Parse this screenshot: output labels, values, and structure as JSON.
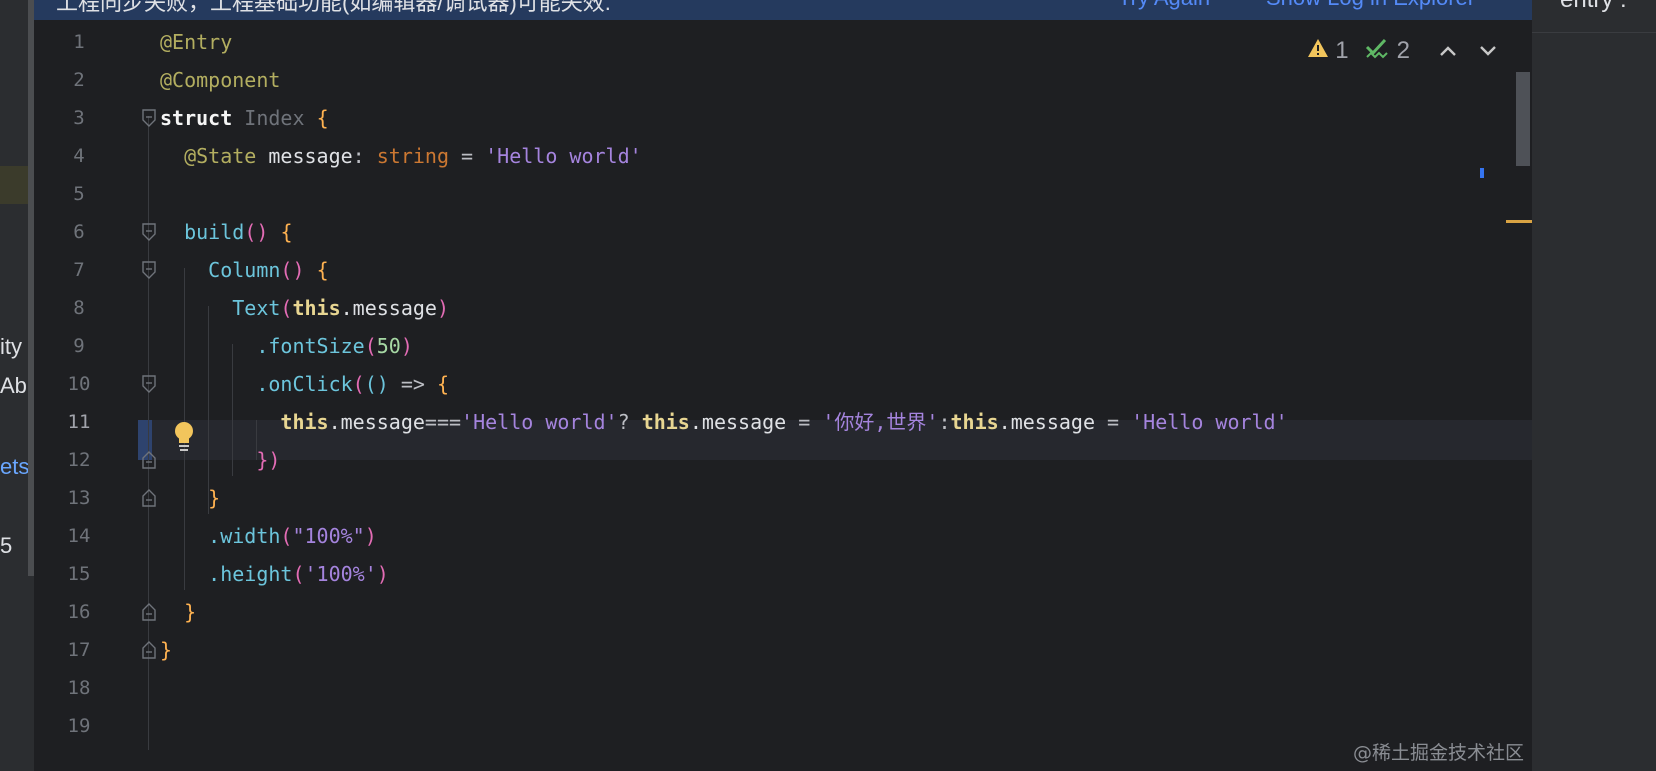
{
  "banner": {
    "message": "工程同步失败，工程基础功能(如编辑器/调试器)可能失效.",
    "try_again": "Try Again",
    "show_log": "Show Log in Explorer"
  },
  "left_panel": {
    "fragments": [
      "",
      "ity",
      "Abil",
      "ets",
      "5"
    ]
  },
  "right_panel": {
    "header": "entry :"
  },
  "inspections": {
    "warnings": "1",
    "weak_warnings": "2"
  },
  "editor": {
    "current_line": 11,
    "line_numbers": [
      "1",
      "2",
      "3",
      "4",
      "5",
      "6",
      "7",
      "8",
      "9",
      "10",
      "11",
      "12",
      "13",
      "14",
      "15",
      "16",
      "17",
      "18",
      "19"
    ],
    "lines": [
      [
        [
          "@Entry",
          "anno"
        ]
      ],
      [
        [
          "@Component",
          "anno"
        ]
      ],
      [
        [
          "struct",
          "kwb"
        ],
        [
          " ",
          "op"
        ],
        [
          "Index",
          "type"
        ],
        [
          " ",
          "op"
        ],
        [
          "{",
          "p1"
        ]
      ],
      [
        [
          "  ",
          "op"
        ],
        [
          "@State",
          "anno"
        ],
        [
          " message",
          "id"
        ],
        [
          ": ",
          "op"
        ],
        [
          "string",
          "tp"
        ],
        [
          " = ",
          "op"
        ],
        [
          "'Hello world'",
          "str"
        ]
      ],
      [],
      [
        [
          "  ",
          "op"
        ],
        [
          "build",
          "comp"
        ],
        [
          "()",
          "p2"
        ],
        [
          " ",
          "op"
        ],
        [
          "{",
          "p1"
        ]
      ],
      [
        [
          "    ",
          "op"
        ],
        [
          "Column",
          "comp"
        ],
        [
          "()",
          "p2"
        ],
        [
          " ",
          "op"
        ],
        [
          "{",
          "p1"
        ]
      ],
      [
        [
          "      ",
          "op"
        ],
        [
          "Text",
          "comp"
        ],
        [
          "(",
          "p2"
        ],
        [
          "this",
          "this"
        ],
        [
          ".message",
          "id"
        ],
        [
          ")",
          "p2"
        ]
      ],
      [
        [
          "        ",
          "op"
        ],
        [
          ".fontSize",
          "meth"
        ],
        [
          "(",
          "p2"
        ],
        [
          "50",
          "num"
        ],
        [
          ")",
          "p2"
        ]
      ],
      [
        [
          "        ",
          "op"
        ],
        [
          ".onClick",
          "meth"
        ],
        [
          "(",
          "p2"
        ],
        [
          "()",
          "p3"
        ],
        [
          " => ",
          "op"
        ],
        [
          "{",
          "p4"
        ]
      ],
      [
        [
          "          ",
          "op"
        ],
        [
          "this",
          "this"
        ],
        [
          ".message",
          "id"
        ],
        [
          "===",
          "op"
        ],
        [
          "'Hello world'",
          "str"
        ],
        [
          "? ",
          "op"
        ],
        [
          "this",
          "this"
        ],
        [
          ".message",
          "id"
        ],
        [
          " = ",
          "op"
        ],
        [
          "'你好,世界'",
          "str"
        ],
        [
          ":",
          "op"
        ],
        [
          "this",
          "this"
        ],
        [
          ".message",
          "id"
        ],
        [
          " = ",
          "op"
        ],
        [
          "'Hello world'",
          "str"
        ]
      ],
      [
        [
          "        ",
          "op"
        ],
        [
          "})",
          "p2"
        ]
      ],
      [
        [
          "    ",
          "op"
        ],
        [
          "}",
          "p1"
        ]
      ],
      [
        [
          "    ",
          "op"
        ],
        [
          ".width",
          "meth"
        ],
        [
          "(",
          "p2"
        ],
        [
          "\"100%\"",
          "str"
        ],
        [
          ")",
          "p2"
        ]
      ],
      [
        [
          "    ",
          "op"
        ],
        [
          ".height",
          "meth"
        ],
        [
          "(",
          "p2"
        ],
        [
          "'100%'",
          "str"
        ],
        [
          ")",
          "p2"
        ]
      ],
      [
        [
          "  ",
          "op"
        ],
        [
          "}",
          "p1"
        ]
      ],
      [
        [
          "}",
          "p1"
        ]
      ],
      [],
      []
    ]
  },
  "watermark": "@稀土掘金技术社区"
}
